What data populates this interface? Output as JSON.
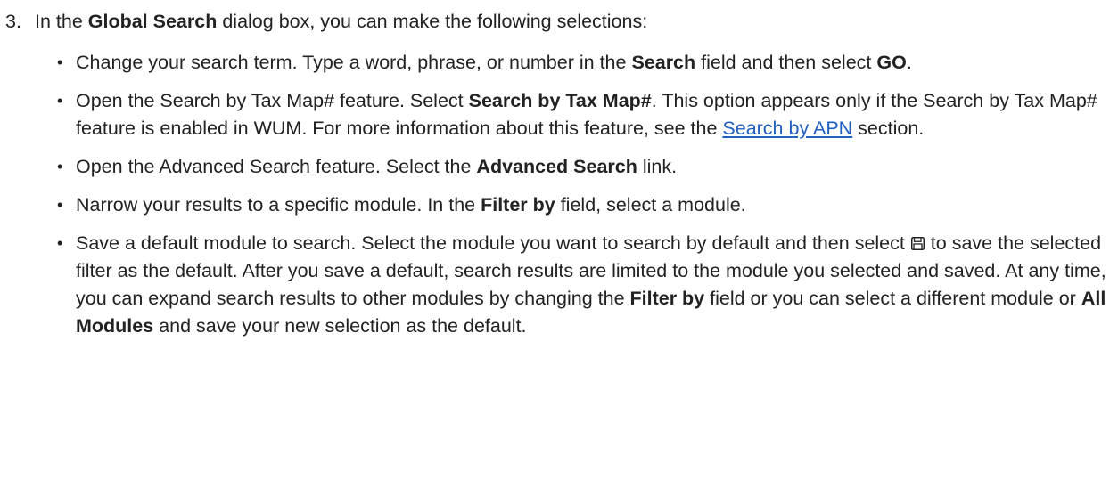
{
  "step": {
    "number": "3.",
    "intro_before": "In the ",
    "intro_bold": "Global Search",
    "intro_after": " dialog box, you can make the following selections:"
  },
  "bullets": {
    "b1": {
      "t1": "Change your search term. Type a word, phrase, or number in the ",
      "bold1": "Search",
      "t2": " field and then select ",
      "bold2": "GO",
      "t3": "."
    },
    "b2": {
      "t1": "Open the Search by Tax Map# feature. Select ",
      "bold1": "Search by Tax Map#",
      "t2": ". This option appears only if the Search by Tax Map# feature is enabled in WUM. For more information about this feature, see the ",
      "link": "Search by APN",
      "t3": " section."
    },
    "b3": {
      "t1": "Open the Advanced Search feature. Select the ",
      "bold1": "Advanced Search",
      "t2": " link."
    },
    "b4": {
      "t1": "Narrow your results to a specific module. In the ",
      "bold1": "Filter by",
      "t2": " field, select a module."
    },
    "b5": {
      "t1": "Save a default module to search. Select the module you want to search by default and then select ",
      "icon": "save-icon",
      "t2": " to save the selected filter as the default. After you save a default, search results are limited to the module you selected and saved. At any time, you can expand search results to other modules by changing the ",
      "bold1": "Filter by",
      "t3": " field or you can select a different module or ",
      "bold2": "All Modules",
      "t4": " and save your new selection as the default."
    }
  },
  "colors": {
    "text": "#222222",
    "link": "#1f5fbf"
  }
}
